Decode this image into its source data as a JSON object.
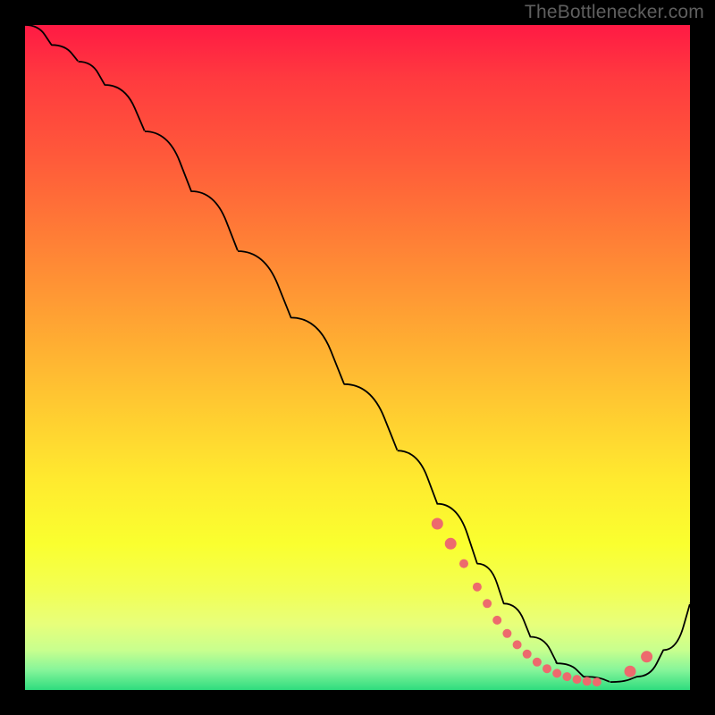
{
  "attribution": "TheBottlenecker.com",
  "chart_data": {
    "type": "line",
    "title": "",
    "xlabel": "",
    "ylabel": "",
    "xlim": [
      0,
      100
    ],
    "ylim": [
      0,
      100
    ],
    "x": [
      0,
      4,
      8,
      12,
      18,
      25,
      32,
      40,
      48,
      56,
      62,
      68,
      72,
      76,
      80,
      84,
      88,
      92,
      96,
      100
    ],
    "y": [
      100,
      97,
      94.5,
      91,
      84,
      75,
      66,
      56,
      46,
      36,
      28,
      19,
      13,
      8,
      4,
      2,
      1.2,
      2,
      6,
      13
    ],
    "marker_points": {
      "x": [
        62,
        64,
        66,
        68,
        69.5,
        71,
        72.5,
        74,
        75.5,
        77,
        78.5,
        80,
        81.5,
        83,
        84.5,
        86,
        91,
        93.5
      ],
      "y": [
        25,
        22,
        19,
        15.5,
        13,
        10.5,
        8.5,
        6.8,
        5.4,
        4.2,
        3.2,
        2.5,
        2,
        1.6,
        1.3,
        1.2,
        2.8,
        5
      ]
    },
    "colors": {
      "line": "#000000",
      "markers": "#ed6a6d",
      "gradient_top": "#ff1a44",
      "gradient_mid": "#ffe92f",
      "gradient_bottom": "#2edc7e"
    }
  }
}
